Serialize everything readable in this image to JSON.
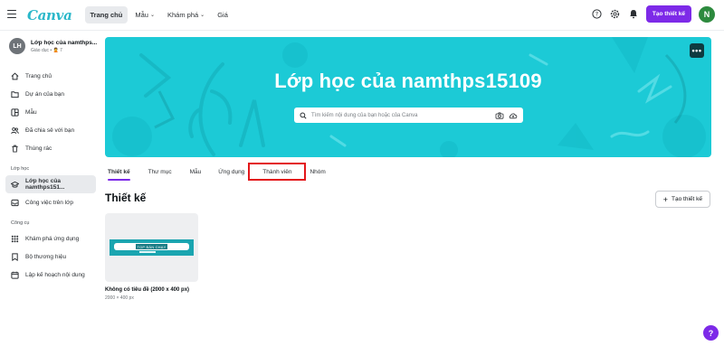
{
  "header": {
    "logo": "Canva",
    "nav": [
      {
        "label": "Trang chủ",
        "active": true,
        "dropdown": false
      },
      {
        "label": "Mẫu",
        "active": false,
        "dropdown": true
      },
      {
        "label": "Khám phá",
        "active": false,
        "dropdown": true
      },
      {
        "label": "Giá",
        "active": false,
        "dropdown": false
      }
    ],
    "create_label": "Tạo thiết kế",
    "user_initial": "N",
    "icons": [
      "help-icon",
      "settings-icon",
      "notification-icon"
    ]
  },
  "sidebar": {
    "team_initials": "LH",
    "team_name": "Lớp học của namthps...",
    "team_sub": "Giáo dục • 🙎 7",
    "items": [
      {
        "label": "Trang chủ",
        "icon": "home-icon"
      },
      {
        "label": "Dự án của bạn",
        "icon": "folder-icon"
      },
      {
        "label": "Mẫu",
        "icon": "template-icon"
      },
      {
        "label": "Đã chia sẻ với bạn",
        "icon": "people-icon"
      },
      {
        "label": "Thùng rác",
        "icon": "trash-icon"
      }
    ],
    "class_heading": "Lớp học",
    "class_items": [
      {
        "label": "Lớp học của namthps151...",
        "icon": "graduation-cap-icon",
        "active": true
      },
      {
        "label": "Công việc trên lớp",
        "icon": "inbox-icon",
        "active": false
      }
    ],
    "tools_heading": "Công cụ",
    "tools_items": [
      {
        "label": "Khám phá ứng dụng",
        "icon": "apps-grid-icon"
      },
      {
        "label": "Bộ thương hiệu",
        "icon": "brand-kit-icon"
      },
      {
        "label": "Lập kế hoạch nội dung",
        "icon": "calendar-icon"
      }
    ]
  },
  "banner": {
    "title": "Lớp học của namthps15109",
    "search_placeholder": "Tìm kiếm nội dung của bạn hoặc của Canva",
    "more_label": "•••",
    "color": "#1ccad6"
  },
  "tabs": [
    {
      "label": "Thiết kế",
      "active": true
    },
    {
      "label": "Thư mục",
      "active": false
    },
    {
      "label": "Mẫu",
      "active": false
    },
    {
      "label": "Ứng dụng",
      "active": false
    },
    {
      "label": "Thành viên",
      "active": false,
      "highlighted": true
    },
    {
      "label": "Nhóm",
      "active": false
    }
  ],
  "designs": {
    "section_title": "Thiết kế",
    "new_label": "Tạo thiết kế",
    "cards": [
      {
        "title": "Không có tiêu đề (2000 x 400 px)",
        "subtitle": "2000 × 400 px",
        "thumb_text": "TOP BÁN CHẠY"
      }
    ]
  },
  "help_label": "?",
  "colors": {
    "accent": "#7d2ae8",
    "highlight": "#e3171a",
    "banner": "#1ccad6"
  }
}
